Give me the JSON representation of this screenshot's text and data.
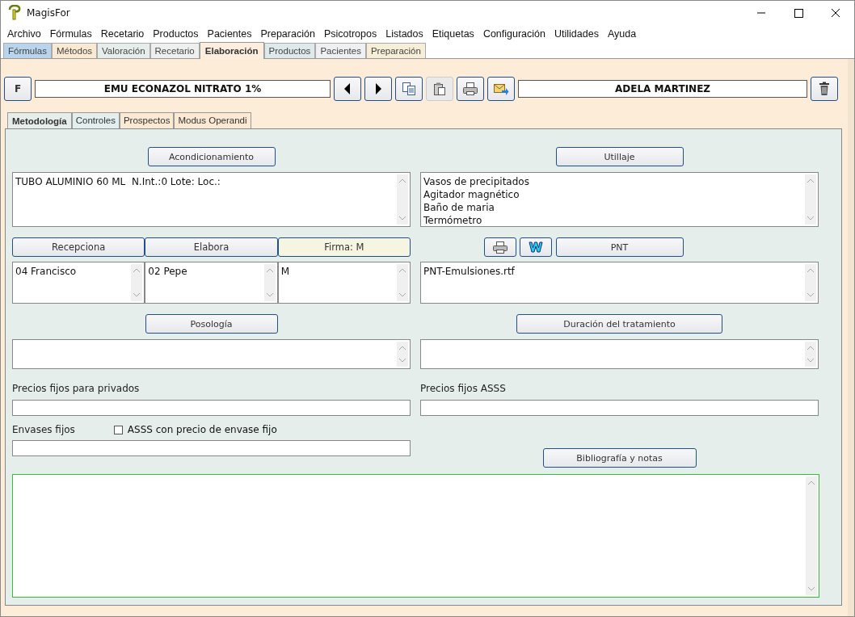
{
  "window": {
    "title": "MagisFor"
  },
  "menu": [
    "Archivo",
    "Fórmulas",
    "Recetario",
    "Productos",
    "Pacientes",
    "Preparación",
    "Psicotropos",
    "Listados",
    "Etiquetas",
    "Configuración",
    "Utilidades",
    "Ayuda"
  ],
  "top_tabs": [
    {
      "label": "Fórmulas",
      "selected": false,
      "color": "#b9d5ee"
    },
    {
      "label": "Métodos",
      "selected": false,
      "color": "#fbe9d3"
    },
    {
      "label": "Valoración",
      "selected": false,
      "color": "#e6eeec"
    },
    {
      "label": "Recetario",
      "selected": false,
      "color": "#eef0f0"
    },
    {
      "label": "Elaboración",
      "selected": true,
      "color": "#fdeedd"
    },
    {
      "label": "Productos",
      "selected": false,
      "color": "#dde9ea"
    },
    {
      "label": "Pacientes",
      "selected": false,
      "color": "#eef0f2"
    },
    {
      "label": "Preparación",
      "selected": false,
      "color": "#f7eed8"
    }
  ],
  "record": {
    "formula_button": "F",
    "formula_name": "EMU ECONAZOL NITRATO 1%",
    "patient_name": "ADELA MARTINEZ"
  },
  "inner_tabs": [
    {
      "label": "Metodología",
      "selected": true,
      "color": "#e6eeec"
    },
    {
      "label": "Controles",
      "selected": false,
      "color": "#e3eeee"
    },
    {
      "label": "Prospectos",
      "selected": false,
      "color": "#fbe9d3"
    },
    {
      "label": "Modus Operandi",
      "selected": false,
      "color": "#fbe9d3"
    }
  ],
  "acondicionamiento": {
    "button": "Acondicionamiento",
    "value": "TUBO ALUMINIO 60 ML  N.Int.:0 Lote: Loc.:"
  },
  "utillaje": {
    "button": "Utillaje",
    "lines": [
      "Vasos de precipitados",
      "Agitador magnético",
      "Baño de maria",
      "Termómetro"
    ]
  },
  "staff": [
    {
      "button": "Recepciona",
      "value": "04 Francisco",
      "highlighted": false
    },
    {
      "button": "Elabora",
      "value": "02 Pepe",
      "highlighted": false
    },
    {
      "button": "Firma: M",
      "value": "M",
      "highlighted": true
    }
  ],
  "pnt": {
    "button": "PNT",
    "value": "PNT-Emulsiones.rtf"
  },
  "posologia": {
    "button": "Posología"
  },
  "duracion": {
    "button": "Duración del tratamiento"
  },
  "precios_privados": {
    "label": "Precios fijos para privados"
  },
  "precios_asss": {
    "label": "Precios fijos ASSS"
  },
  "envases_fijos": {
    "label": "Envases fijos"
  },
  "asss_checkbox": {
    "label": "ASSS con precio de envase fijo",
    "checked": false
  },
  "bibliografia": {
    "button": "Bibliografía y notas"
  }
}
